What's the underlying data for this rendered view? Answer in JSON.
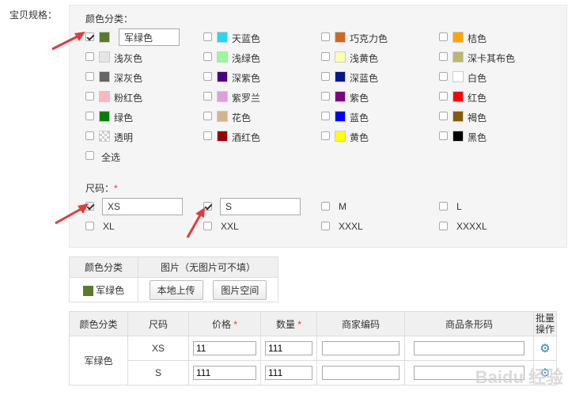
{
  "spec_label": "宝贝规格：",
  "color_section": {
    "title": "颜色分类：",
    "custom_input_value": "军绿色",
    "items": [
      {
        "label": "天蓝色",
        "color": "#27d7f2",
        "checked": false
      },
      {
        "label": "巧克力色",
        "color": "#d2691e",
        "checked": false
      },
      {
        "label": "桔色",
        "color": "#ffa500",
        "checked": false
      },
      {
        "label": "浅灰色",
        "color": "#e5e5e5",
        "checked": false
      },
      {
        "label": "浅绿色",
        "color": "#98fb98",
        "checked": false
      },
      {
        "label": "浅黄色",
        "color": "#ffffb1",
        "checked": false
      },
      {
        "label": "深卡其布色",
        "color": "#bdb76b",
        "checked": false
      },
      {
        "label": "深灰色",
        "color": "#666666",
        "checked": false
      },
      {
        "label": "深紫色",
        "color": "#4b0082",
        "checked": false
      },
      {
        "label": "深蓝色",
        "color": "#041690",
        "checked": false
      },
      {
        "label": "白色",
        "color": "#ffffff",
        "checked": false
      },
      {
        "label": "粉红色",
        "color": "#ffb6c1",
        "checked": false
      },
      {
        "label": "紫罗兰",
        "color": "#dda0dd",
        "checked": false
      },
      {
        "label": "紫色",
        "color": "#800080",
        "checked": false
      },
      {
        "label": "红色",
        "color": "#ff0000",
        "checked": false
      },
      {
        "label": "绿色",
        "color": "#008000",
        "checked": false
      },
      {
        "label": "花色",
        "color": "#d2b48c",
        "checked": false
      },
      {
        "label": "蓝色",
        "color": "#0000ff",
        "checked": false
      },
      {
        "label": "褐色",
        "color": "#855b00",
        "checked": false
      },
      {
        "label": "透明",
        "color": "transparent",
        "checked": false
      },
      {
        "label": "酒红色",
        "color": "#990000",
        "checked": false
      },
      {
        "label": "黄色",
        "color": "#ffff00",
        "checked": false
      },
      {
        "label": "黑色",
        "color": "#000000",
        "checked": false
      }
    ],
    "first_item": {
      "color": "#5b7a2b",
      "checked": true
    },
    "select_all_label": "全选"
  },
  "size_section": {
    "title": "尺码：",
    "required_mark": "*",
    "sizes": [
      {
        "label": "XS",
        "checked": true,
        "input_value": "XS"
      },
      {
        "label": "S",
        "checked": true,
        "input_value": "S"
      },
      {
        "label": "M",
        "checked": false
      },
      {
        "label": "L",
        "checked": false
      },
      {
        "label": "XL",
        "checked": false
      },
      {
        "label": "XXL",
        "checked": false
      },
      {
        "label": "XXXL",
        "checked": false
      },
      {
        "label": "XXXXL",
        "checked": false
      }
    ]
  },
  "image_table": {
    "col_color": "颜色分类",
    "col_image": "图片（无图片可不填）",
    "row_color_label": "军绿色",
    "row_color": "#5b7a2b",
    "upload_local": "本地上传",
    "image_space": "图片空间"
  },
  "sku_table": {
    "headers": {
      "color": "颜色分类",
      "size": "尺码",
      "price": "价格",
      "qty": "数量",
      "merchant_code": "商家编码",
      "barcode": "商品条形码",
      "batch": "批量操作"
    },
    "required_mark": "*",
    "color_group": "军绿色",
    "rows": [
      {
        "size": "XS",
        "price": "11",
        "qty": "111",
        "merchant_code": "",
        "barcode": ""
      },
      {
        "size": "S",
        "price": "111",
        "qty": "111",
        "merchant_code": "",
        "barcode": ""
      }
    ]
  },
  "watermark_text": "Baidu 经验",
  "accent_arrow_color": "#e4393c"
}
